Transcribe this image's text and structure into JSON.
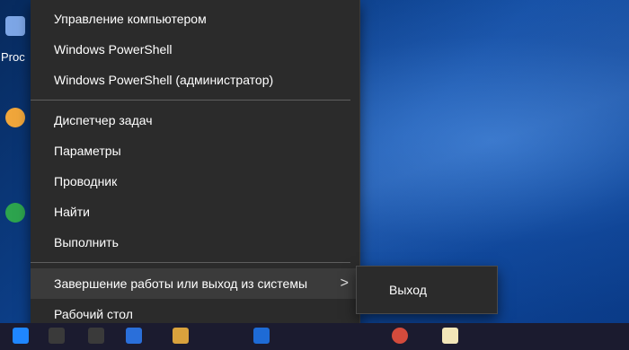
{
  "desktop": {
    "label_text": "Proc",
    "icons": [
      {
        "name": "app-icon-top"
      },
      {
        "name": "app-icon-orange"
      },
      {
        "name": "app-icon-chrome"
      }
    ]
  },
  "context_menu": {
    "items": [
      {
        "label": "Управление компьютером"
      },
      {
        "label": "Windows PowerShell"
      },
      {
        "label": "Windows PowerShell (администратор)"
      },
      {
        "label": "Диспетчер задач"
      },
      {
        "label": "Параметры"
      },
      {
        "label": "Проводник"
      },
      {
        "label": "Найти"
      },
      {
        "label": "Выполнить"
      },
      {
        "label": "Завершение работы или выход из системы",
        "has_submenu": true
      },
      {
        "label": "Рабочий стол"
      }
    ],
    "submenu_arrow": ">",
    "submenu": {
      "items": [
        {
          "label": "Выход"
        }
      ]
    }
  },
  "taskbar": {
    "icons": [
      {
        "name": "start-icon"
      },
      {
        "name": "search-icon"
      },
      {
        "name": "taskview-icon"
      },
      {
        "name": "edge-icon"
      },
      {
        "name": "folder-icon"
      },
      {
        "name": "store-icon"
      },
      {
        "name": "media-icon"
      },
      {
        "name": "notes-icon"
      }
    ]
  },
  "colors": {
    "menu_bg": "#2b2b2b",
    "menu_text": "#ffffff",
    "highlight_bg": "#3b3b3b",
    "desktop_bg": "#0f4aa0"
  }
}
